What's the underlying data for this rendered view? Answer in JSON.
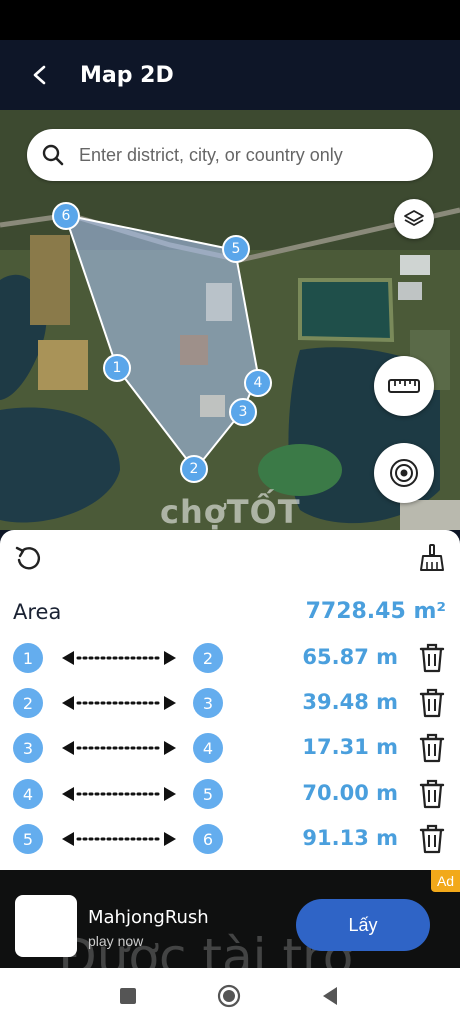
{
  "header": {
    "title": "Map 2D",
    "back_icon": "arrow-left-icon"
  },
  "search": {
    "placeholder": "Enter district, city, or country only"
  },
  "map": {
    "watermark": "chợTỐT",
    "vertices": [
      "1",
      "2",
      "3",
      "4",
      "5",
      "6"
    ],
    "fill_color": "#9fb8e8",
    "point_color": "#5aa6ea"
  },
  "panel": {
    "area_label": "Area",
    "area_value": "7728.45 m²",
    "segments": [
      {
        "from": "1",
        "to": "2",
        "distance": "65.87 m"
      },
      {
        "from": "2",
        "to": "3",
        "distance": "39.48 m"
      },
      {
        "from": "3",
        "to": "4",
        "distance": "17.31 m"
      },
      {
        "from": "4",
        "to": "5",
        "distance": "70.00 m"
      },
      {
        "from": "5",
        "to": "6",
        "distance": "91.13 m"
      }
    ]
  },
  "ad": {
    "badge": "Ad",
    "title": "MahjongRush",
    "subtitle": "play now",
    "button": "Lấy",
    "overlay_text": "Được tài trợ"
  },
  "colors": {
    "accent": "#4a9fdd",
    "point": "#64adee",
    "appbar": "#0e1628"
  }
}
